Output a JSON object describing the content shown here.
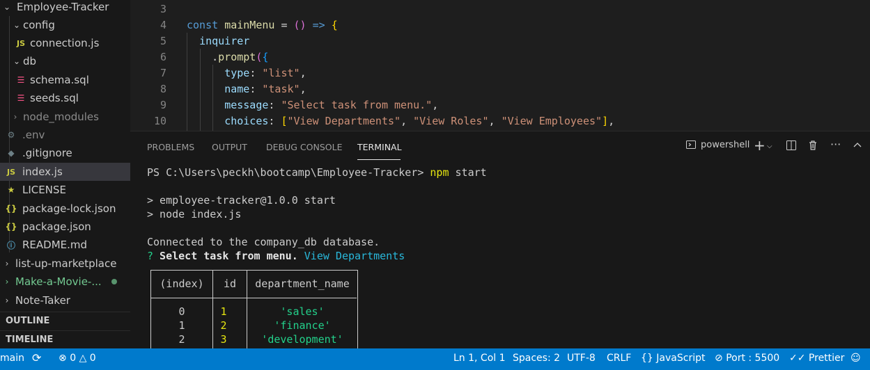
{
  "explorer": {
    "root": "Employee-Tracker",
    "items": [
      {
        "label": "config",
        "icon": "folder-open-chevron"
      },
      {
        "label": "connection.js",
        "icon": "js-icon"
      },
      {
        "label": "db",
        "icon": "folder-open-chevron"
      },
      {
        "label": "schema.sql",
        "icon": "database-icon"
      },
      {
        "label": "seeds.sql",
        "icon": "database-icon"
      },
      {
        "label": "node_modules",
        "icon": "folder-closed-chevron"
      },
      {
        "label": ".env",
        "icon": "gear-icon"
      },
      {
        "label": ".gitignore",
        "icon": "git-icon"
      },
      {
        "label": "index.js",
        "icon": "js-icon"
      },
      {
        "label": "LICENSE",
        "icon": "license-icon"
      },
      {
        "label": "package-lock.json",
        "icon": "json-icon"
      },
      {
        "label": "package.json",
        "icon": "json-icon"
      },
      {
        "label": "README.md",
        "icon": "info-icon"
      }
    ],
    "other_folders": [
      "list-up-marketplace",
      "Make-a-Movie-...",
      "Note-Taker"
    ],
    "outline": "OUTLINE",
    "timeline": "TIMELINE"
  },
  "editor": {
    "lines": [
      {
        "n": "3"
      },
      {
        "n": "4",
        "t": {
          "kw": "const",
          "name": "mainMenu",
          "eq": " = ",
          "paren": "()",
          "arrow": " => ",
          "brace": "{"
        }
      },
      {
        "n": "5",
        "t": {
          "var": "inquirer"
        }
      },
      {
        "n": "6",
        "t": {
          "dot": ".",
          "fn": "prompt",
          "open": "(",
          "brace": "{"
        }
      },
      {
        "n": "7",
        "t": {
          "key": "type",
          "colon": ": ",
          "str": "\"list\"",
          "comma": ","
        }
      },
      {
        "n": "8",
        "t": {
          "key": "name",
          "colon": ": ",
          "str": "\"task\"",
          "comma": ","
        }
      },
      {
        "n": "9",
        "t": {
          "key": "message",
          "colon": ": ",
          "str": "\"Select task from menu.\"",
          "comma": ","
        }
      },
      {
        "n": "10",
        "t": {
          "key": "choices",
          "colon": ": ",
          "open": "[",
          "s1": "\"View Departments\"",
          "s2": "\"View Roles\"",
          "s3": "\"View Employees\"",
          "close": "]",
          "comma": ","
        }
      }
    ]
  },
  "panel": {
    "tabs": [
      "PROBLEMS",
      "OUTPUT",
      "DEBUG CONSOLE",
      "TERMINAL"
    ],
    "active_tab": "TERMINAL",
    "shell": "powershell",
    "terminal": {
      "prompt": "PS C:\\Users\\peckh\\bootcamp\\Employee-Tracker> ",
      "command_name": "npm",
      "command_args": " start",
      "line2": "> employee-tracker@1.0.0 start",
      "line3": "> node index.js",
      "line4": "Connected to the company_db database.",
      "q_mark": "?",
      "q_text": " Select task from menu.",
      "q_answer": " View Departments",
      "table": {
        "headers": [
          "(index)",
          "id",
          "department_name"
        ],
        "rows": [
          [
            "0",
            "1",
            "'sales'"
          ],
          [
            "1",
            "2",
            "'finance'"
          ],
          [
            "2",
            "3",
            "'development'"
          ]
        ]
      }
    }
  },
  "status": {
    "branch": "main",
    "errors": "0",
    "warnings": "0",
    "position": "Ln 1, Col 1",
    "spaces": "Spaces: 2",
    "encoding": "UTF-8",
    "eol": "CRLF",
    "language": "JavaScript",
    "port": "Port : 5500",
    "prettier": "Prettier"
  }
}
